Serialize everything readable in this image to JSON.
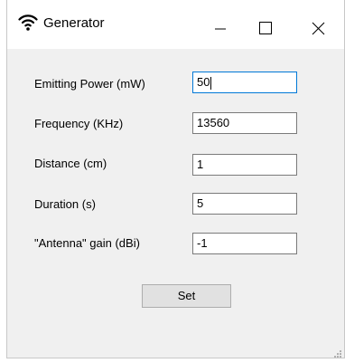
{
  "window": {
    "title": "Generator",
    "icon": "wifi-icon",
    "controls": [
      "minimize-icon",
      "maximize-icon",
      "close-icon"
    ]
  },
  "form": {
    "emitting_power": {
      "label": "Emitting Power (mW)",
      "value": "50"
    },
    "frequency": {
      "label": "Frequency (KHz)",
      "value": "13560"
    },
    "distance": {
      "label": "Distance (cm)",
      "value": "1"
    },
    "duration": {
      "label": "Duration (s)",
      "value": "5"
    },
    "antenna_gain": {
      "label": "\"Antenna\" gain (dBi)",
      "value": "-1"
    }
  },
  "set_button": {
    "label": "Set"
  },
  "colors": {
    "accent": "#0078d7",
    "background": "#f0f0f0",
    "titlebar": "#ffffff"
  }
}
